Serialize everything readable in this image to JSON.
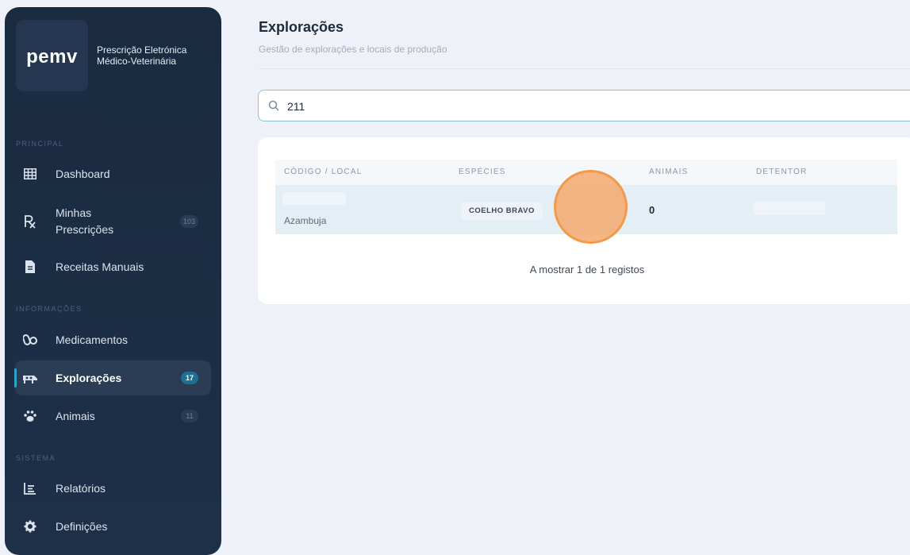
{
  "brand": {
    "logo": "pemv",
    "line1": "Prescrição Eletrónica",
    "line2": "Médico-Veterinária"
  },
  "sidebar": {
    "sections": {
      "principal": "PRINCIPAL",
      "informacoes": "INFORMAÇÕES",
      "sistema": "SISTEMA"
    },
    "items": [
      {
        "label": "Dashboard",
        "icon": "grid-icon"
      },
      {
        "label_line1": "Minhas",
        "label_line2": "Prescrições",
        "badge": "103",
        "icon": "rx-icon"
      },
      {
        "label": "Receitas Manuais",
        "icon": "document-icon"
      },
      {
        "label": "Medicamentos",
        "icon": "pills-icon"
      },
      {
        "label": "Explorações",
        "badge": "17",
        "icon": "farm-icon",
        "active": true
      },
      {
        "label": "Animais",
        "badge": "11",
        "icon": "paw-icon"
      },
      {
        "label": "Relatórios",
        "icon": "report-icon"
      },
      {
        "label": "Definições",
        "icon": "gear-icon"
      }
    ]
  },
  "header": {
    "title": "Explorações",
    "subtitle": "Gestão de explorações e locais de produção"
  },
  "search": {
    "value": "211"
  },
  "table": {
    "columns": [
      "CÓDIGO / LOCAL",
      "ESPÉCIES",
      "ANIMAIS",
      "DETENTOR"
    ],
    "rows": [
      {
        "local": "Azambuja",
        "species": "COELHO BRAVO",
        "animals": "0"
      }
    ],
    "footer": "A mostrar 1 de 1 registos"
  },
  "colors": {
    "sidebar_bg": "#1a2b40",
    "accent": "#2fa3c9",
    "click_indicator": "#f29a4a"
  }
}
